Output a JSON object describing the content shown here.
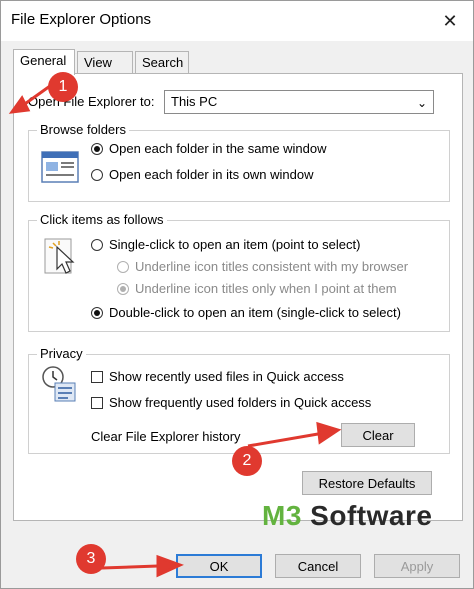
{
  "window": {
    "title": "File Explorer Options",
    "close_glyph": "✕"
  },
  "tabs": [
    "General",
    "View",
    "Search"
  ],
  "general": {
    "open_label": "Open File Explorer to:",
    "open_value": "This PC",
    "browse": {
      "title": "Browse folders",
      "options": [
        "Open each folder in the same window",
        "Open each folder in its own window"
      ],
      "selected": 0
    },
    "click": {
      "title": "Click items as follows",
      "single": "Single-click to open an item (point to select)",
      "sub1": "Underline icon titles consistent with my browser",
      "sub2": "Underline icon titles only when I point at them",
      "double": "Double-click to open an item (single-click to select)"
    },
    "privacy": {
      "title": "Privacy",
      "recent_files": "Show recently used files in Quick access",
      "frequent_folders": "Show frequently used folders in Quick access",
      "clear_label": "Clear File Explorer history",
      "clear_button": "Clear"
    },
    "restore_button": "Restore Defaults"
  },
  "footer": {
    "ok": "OK",
    "cancel": "Cancel",
    "apply": "Apply"
  },
  "annotations": {
    "b1": "1",
    "b2": "2",
    "b3": "3",
    "color": "#e0392f"
  },
  "watermark": {
    "m3": "M3",
    "text": " Software"
  },
  "icons": [
    "close-icon",
    "chevron-down-icon",
    "folder-window-icon",
    "pointer-click-icon",
    "privacy-icon"
  ]
}
